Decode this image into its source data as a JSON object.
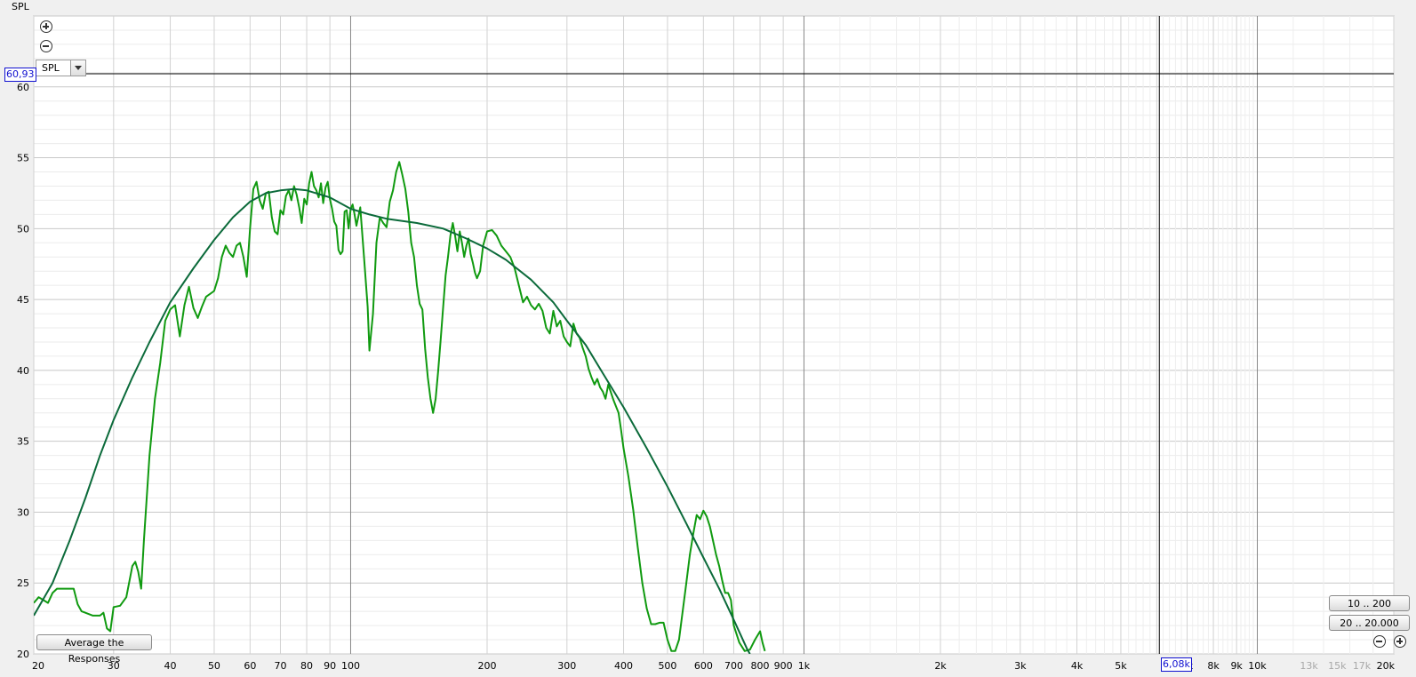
{
  "ylabel": "SPL",
  "selector": {
    "value": "SPL"
  },
  "cursor": {
    "y_value": "60,93",
    "x_value": "6,08k",
    "y_db": 60.93,
    "x_hz": 6080
  },
  "buttons": {
    "average": "Average the Responses",
    "range_10_200": "10 .. 200",
    "range_20_20000": "20 .. 20.000"
  },
  "colors": {
    "measured": "#109a10",
    "smoothed": "#0b6a3a",
    "grid": "#cfcfcf",
    "grid_major": "#888888",
    "cursor": "#000000"
  },
  "chart_data": {
    "type": "line",
    "xscale": "log",
    "xlim": [
      20,
      20000
    ],
    "ylim": [
      20,
      65
    ],
    "grid": true,
    "ylabel": "SPL",
    "x_ticks": [
      {
        "v": 20,
        "t": "20"
      },
      {
        "v": 30,
        "t": "30"
      },
      {
        "v": 40,
        "t": "40"
      },
      {
        "v": 50,
        "t": "50"
      },
      {
        "v": 60,
        "t": "60"
      },
      {
        "v": 70,
        "t": "70"
      },
      {
        "v": 80,
        "t": "80"
      },
      {
        "v": 90,
        "t": "90"
      },
      {
        "v": 100,
        "t": "100"
      },
      {
        "v": 200,
        "t": "200"
      },
      {
        "v": 300,
        "t": "300"
      },
      {
        "v": 400,
        "t": "400"
      },
      {
        "v": 500,
        "t": "500"
      },
      {
        "v": 600,
        "t": "600"
      },
      {
        "v": 700,
        "t": "700"
      },
      {
        "v": 800,
        "t": "800"
      },
      {
        "v": 900,
        "t": "900"
      },
      {
        "v": 1000,
        "t": "1k"
      },
      {
        "v": 2000,
        "t": "2k"
      },
      {
        "v": 3000,
        "t": "3k"
      },
      {
        "v": 4000,
        "t": "4k"
      },
      {
        "v": 5000,
        "t": "5k"
      },
      {
        "v": 7000,
        "t": "7k"
      },
      {
        "v": 8000,
        "t": "8k"
      },
      {
        "v": 9000,
        "t": "9k"
      },
      {
        "v": 10000,
        "t": "10k"
      },
      {
        "v": 13000,
        "t": "13k",
        "dim": true
      },
      {
        "v": 15000,
        "t": "15k",
        "dim": true
      },
      {
        "v": 17000,
        "t": "17k",
        "dim": true
      },
      {
        "v": 20000,
        "t": "20k"
      }
    ],
    "y_ticks": [
      20,
      25,
      30,
      35,
      40,
      45,
      50,
      55,
      60
    ],
    "series": [
      {
        "color": "#109a10",
        "points": [
          [
            20,
            23.6
          ],
          [
            20.5,
            24.0
          ],
          [
            21,
            23.8
          ],
          [
            21.5,
            23.6
          ],
          [
            22,
            24.3
          ],
          [
            22.5,
            24.6
          ],
          [
            23.5,
            24.6
          ],
          [
            24.5,
            24.6
          ],
          [
            25,
            23.5
          ],
          [
            25.5,
            23.0
          ],
          [
            26,
            22.9
          ],
          [
            27,
            22.7
          ],
          [
            28,
            22.7
          ],
          [
            28.5,
            22.9
          ],
          [
            29,
            21.8
          ],
          [
            29.5,
            21.6
          ],
          [
            30,
            23.3
          ],
          [
            31,
            23.4
          ],
          [
            32,
            24.0
          ],
          [
            33,
            26.2
          ],
          [
            33.5,
            26.5
          ],
          [
            34,
            25.8
          ],
          [
            34.5,
            24.6
          ],
          [
            35,
            28.0
          ],
          [
            36,
            34.0
          ],
          [
            37,
            38.0
          ],
          [
            38,
            40.5
          ],
          [
            39,
            43.5
          ],
          [
            40,
            44.3
          ],
          [
            41,
            44.6
          ],
          [
            42,
            42.4
          ],
          [
            43,
            44.6
          ],
          [
            44,
            45.9
          ],
          [
            45,
            44.4
          ],
          [
            46,
            43.7
          ],
          [
            47,
            44.5
          ],
          [
            48,
            45.2
          ],
          [
            49,
            45.4
          ],
          [
            50,
            45.6
          ],
          [
            51,
            46.5
          ],
          [
            52,
            48.0
          ],
          [
            53,
            48.8
          ],
          [
            54,
            48.3
          ],
          [
            55,
            48.0
          ],
          [
            56,
            48.8
          ],
          [
            57,
            49.0
          ],
          [
            58,
            48.0
          ],
          [
            59,
            46.6
          ],
          [
            60,
            50.0
          ],
          [
            61,
            52.8
          ],
          [
            62,
            53.3
          ],
          [
            63,
            52.0
          ],
          [
            64,
            51.4
          ],
          [
            65,
            52.5
          ],
          [
            66,
            52.6
          ],
          [
            67,
            50.8
          ],
          [
            68,
            49.8
          ],
          [
            69,
            49.6
          ],
          [
            70,
            51.3
          ],
          [
            71,
            51.0
          ],
          [
            72,
            52.3
          ],
          [
            73,
            52.7
          ],
          [
            74,
            52.0
          ],
          [
            75,
            53.0
          ],
          [
            76,
            52.4
          ],
          [
            77,
            51.5
          ],
          [
            78,
            50.4
          ],
          [
            79,
            52.1
          ],
          [
            80,
            51.7
          ],
          [
            81,
            53.2
          ],
          [
            82,
            54.0
          ],
          [
            83,
            53.0
          ],
          [
            84,
            52.7
          ],
          [
            85,
            52.2
          ],
          [
            86,
            53.2
          ],
          [
            87,
            51.8
          ],
          [
            88,
            52.9
          ],
          [
            89,
            53.3
          ],
          [
            90,
            52.1
          ],
          [
            91,
            51.4
          ],
          [
            92,
            50.5
          ],
          [
            93,
            50.2
          ],
          [
            94,
            48.5
          ],
          [
            95,
            48.2
          ],
          [
            96,
            48.4
          ],
          [
            97,
            51.2
          ],
          [
            98,
            51.3
          ],
          [
            99,
            50.0
          ],
          [
            100,
            51.4
          ],
          [
            101,
            51.7
          ],
          [
            102,
            51.0
          ],
          [
            103,
            50.2
          ],
          [
            105,
            51.5
          ],
          [
            107,
            48.0
          ],
          [
            109,
            44.5
          ],
          [
            110,
            41.4
          ],
          [
            112,
            44.0
          ],
          [
            114,
            49.0
          ],
          [
            116,
            50.8
          ],
          [
            118,
            50.4
          ],
          [
            120,
            50.1
          ],
          [
            122,
            51.9
          ],
          [
            124,
            52.7
          ],
          [
            126,
            54.0
          ],
          [
            128,
            54.7
          ],
          [
            130,
            53.8
          ],
          [
            132,
            52.8
          ],
          [
            134,
            51.2
          ],
          [
            136,
            49.0
          ],
          [
            138,
            48.0
          ],
          [
            140,
            46.0
          ],
          [
            142,
            44.7
          ],
          [
            144,
            44.3
          ],
          [
            146,
            41.5
          ],
          [
            148,
            39.5
          ],
          [
            150,
            38.0
          ],
          [
            152,
            37.0
          ],
          [
            154,
            38.0
          ],
          [
            156,
            40.0
          ],
          [
            158,
            42.2
          ],
          [
            160,
            44.5
          ],
          [
            162,
            46.7
          ],
          [
            164,
            48.0
          ],
          [
            166,
            49.5
          ],
          [
            168,
            50.4
          ],
          [
            170,
            49.5
          ],
          [
            172,
            48.4
          ],
          [
            174,
            49.8
          ],
          [
            176,
            49.0
          ],
          [
            178,
            48.0
          ],
          [
            180,
            48.8
          ],
          [
            182,
            49.3
          ],
          [
            184,
            48.2
          ],
          [
            186,
            47.6
          ],
          [
            188,
            46.9
          ],
          [
            190,
            46.5
          ],
          [
            193,
            47.0
          ],
          [
            196,
            48.8
          ],
          [
            200,
            49.8
          ],
          [
            205,
            49.9
          ],
          [
            210,
            49.5
          ],
          [
            215,
            48.8
          ],
          [
            220,
            48.4
          ],
          [
            225,
            48.0
          ],
          [
            230,
            47.2
          ],
          [
            235,
            46.0
          ],
          [
            240,
            44.8
          ],
          [
            245,
            45.2
          ],
          [
            250,
            44.6
          ],
          [
            255,
            44.3
          ],
          [
            260,
            44.7
          ],
          [
            265,
            44.2
          ],
          [
            270,
            43.0
          ],
          [
            275,
            42.6
          ],
          [
            280,
            44.2
          ],
          [
            285,
            43.1
          ],
          [
            290,
            43.5
          ],
          [
            295,
            42.4
          ],
          [
            300,
            42.0
          ],
          [
            305,
            41.7
          ],
          [
            310,
            43.3
          ],
          [
            315,
            42.6
          ],
          [
            320,
            42.3
          ],
          [
            325,
            41.6
          ],
          [
            330,
            41.0
          ],
          [
            335,
            40.1
          ],
          [
            340,
            39.5
          ],
          [
            345,
            39.0
          ],
          [
            350,
            39.4
          ],
          [
            355,
            38.8
          ],
          [
            360,
            38.5
          ],
          [
            365,
            38.0
          ],
          [
            370,
            39.0
          ],
          [
            380,
            37.9
          ],
          [
            390,
            37.0
          ],
          [
            395,
            35.8
          ],
          [
            400,
            34.5
          ],
          [
            410,
            32.5
          ],
          [
            420,
            30.2
          ],
          [
            430,
            27.5
          ],
          [
            440,
            25.0
          ],
          [
            450,
            23.2
          ],
          [
            460,
            22.1
          ],
          [
            470,
            22.1
          ],
          [
            480,
            22.2
          ],
          [
            490,
            22.2
          ],
          [
            500,
            21.0
          ],
          [
            510,
            20.2
          ],
          [
            520,
            20.2
          ],
          [
            530,
            21.0
          ],
          [
            540,
            23.0
          ],
          [
            550,
            25.0
          ],
          [
            560,
            27.0
          ],
          [
            570,
            28.5
          ],
          [
            580,
            29.8
          ],
          [
            590,
            29.5
          ],
          [
            600,
            30.1
          ],
          [
            610,
            29.7
          ],
          [
            620,
            29.0
          ],
          [
            630,
            28.0
          ],
          [
            640,
            27.0
          ],
          [
            650,
            26.2
          ],
          [
            660,
            25.2
          ],
          [
            670,
            24.3
          ],
          [
            680,
            24.3
          ],
          [
            690,
            23.8
          ],
          [
            700,
            22.0
          ],
          [
            720,
            20.8
          ],
          [
            740,
            20.2
          ],
          [
            760,
            20.3
          ],
          [
            780,
            21.0
          ],
          [
            800,
            21.6
          ],
          [
            810,
            20.8
          ],
          [
            820,
            20.2
          ]
        ]
      },
      {
        "color": "#0b6a3a",
        "points": [
          [
            20,
            22.7
          ],
          [
            22,
            25.0
          ],
          [
            24,
            28.0
          ],
          [
            26,
            31.0
          ],
          [
            28,
            34.0
          ],
          [
            30,
            36.5
          ],
          [
            33,
            39.5
          ],
          [
            36,
            42.0
          ],
          [
            40,
            44.8
          ],
          [
            45,
            47.2
          ],
          [
            50,
            49.2
          ],
          [
            55,
            50.8
          ],
          [
            60,
            51.9
          ],
          [
            65,
            52.5
          ],
          [
            70,
            52.7
          ],
          [
            75,
            52.8
          ],
          [
            80,
            52.7
          ],
          [
            90,
            52.2
          ],
          [
            100,
            51.4
          ],
          [
            110,
            51.0
          ],
          [
            120,
            50.7
          ],
          [
            140,
            50.4
          ],
          [
            160,
            50.0
          ],
          [
            180,
            49.3
          ],
          [
            200,
            48.6
          ],
          [
            220,
            47.8
          ],
          [
            250,
            46.4
          ],
          [
            280,
            44.8
          ],
          [
            300,
            43.5
          ],
          [
            330,
            41.8
          ],
          [
            360,
            39.8
          ],
          [
            400,
            37.4
          ],
          [
            450,
            34.5
          ],
          [
            500,
            31.8
          ],
          [
            550,
            29.2
          ],
          [
            600,
            26.8
          ],
          [
            650,
            24.6
          ],
          [
            700,
            22.4
          ],
          [
            750,
            20.3
          ],
          [
            760,
            20.0
          ]
        ]
      }
    ]
  }
}
